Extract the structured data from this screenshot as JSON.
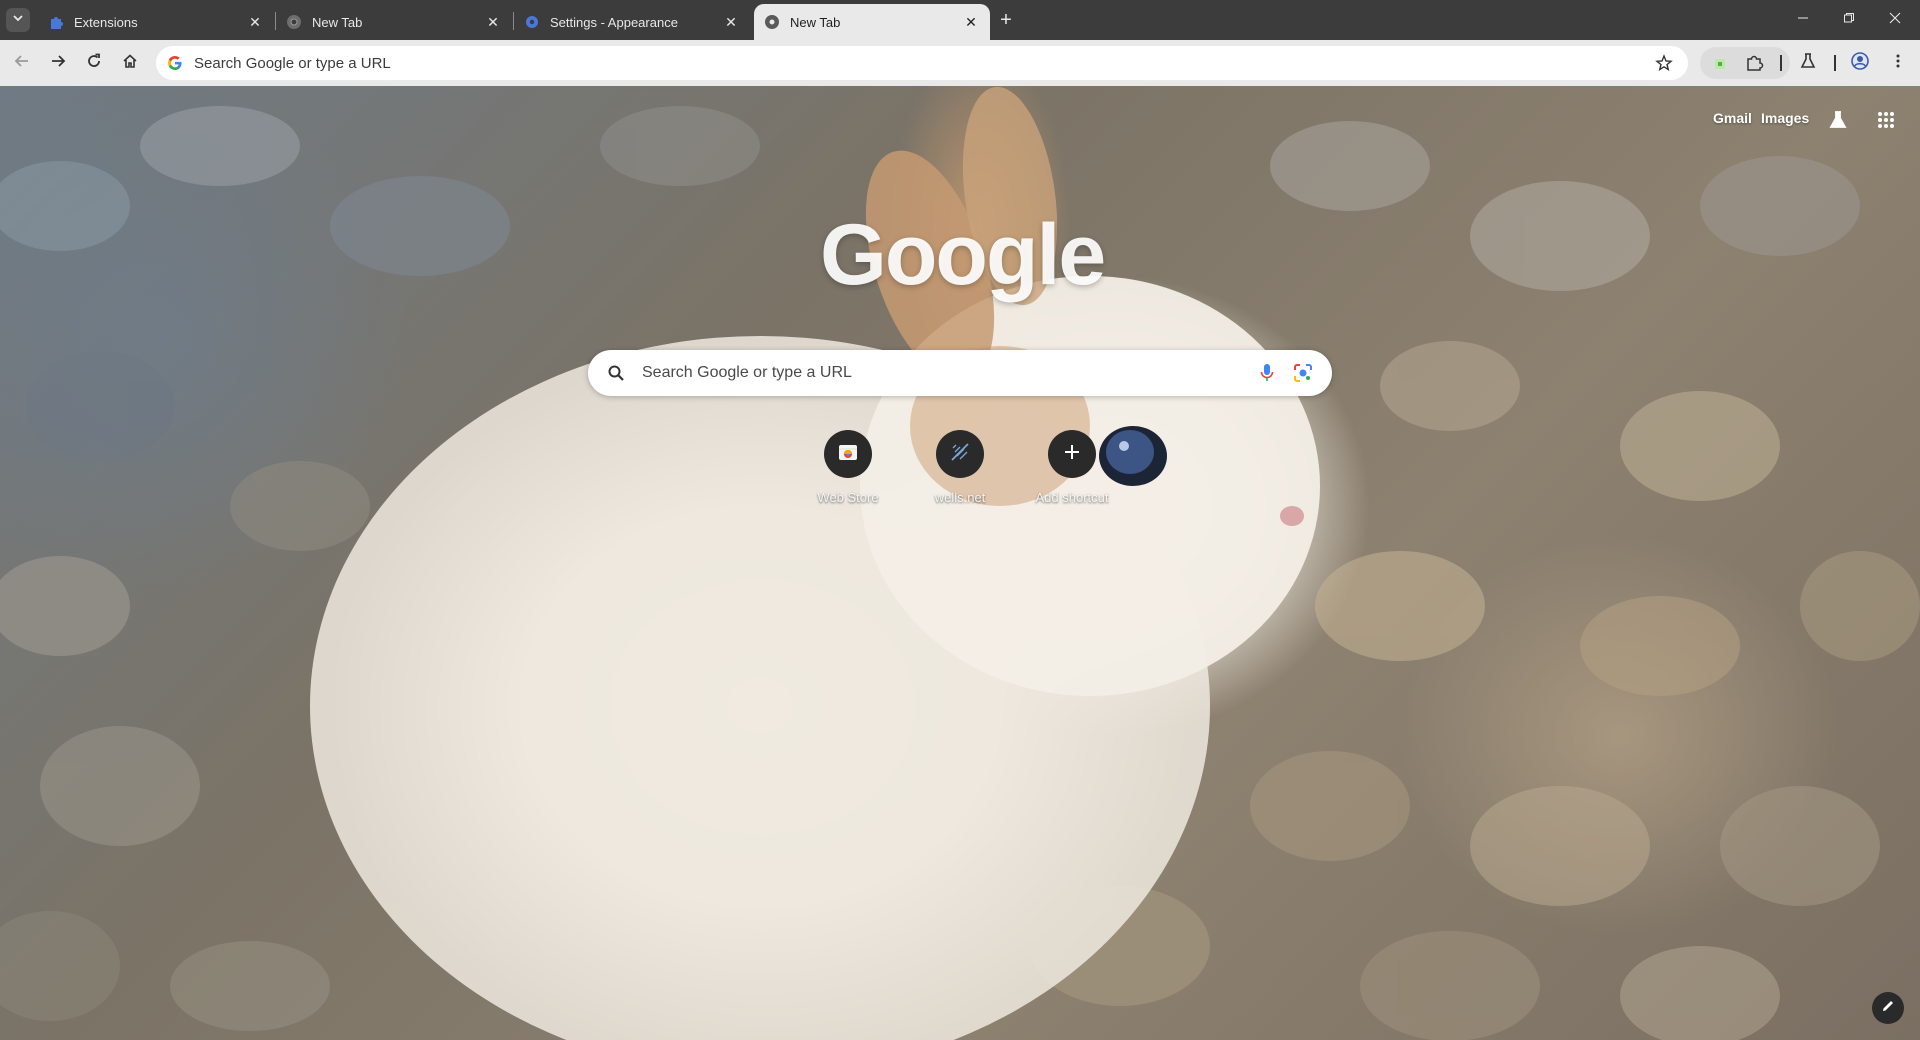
{
  "tabs": [
    {
      "title": "Extensions",
      "icon": "puzzle-icon",
      "active": false
    },
    {
      "title": "New Tab",
      "icon": "chrome-icon",
      "active": false
    },
    {
      "title": "Settings - Appearance",
      "icon": "gear-icon",
      "active": false
    },
    {
      "title": "New Tab",
      "icon": "chrome-icon",
      "active": true
    }
  ],
  "toolbar": {
    "omnibox_text": "Search Google or type a URL"
  },
  "ntp": {
    "gmail_label": "Gmail",
    "images_label": "Images",
    "logo_text": "Google",
    "search_placeholder": "Search Google or type a URL",
    "shortcuts": [
      {
        "label": "Web Store",
        "icon": "web-store-icon"
      },
      {
        "label": "wells.net",
        "icon": "wells-icon"
      },
      {
        "label": "Add shortcut",
        "icon": "plus-icon"
      }
    ]
  },
  "colors": {
    "tabstrip": "#3c3c3c",
    "toolbar": "#e9e9e9",
    "active_tab": "#e9e9e9",
    "shortcut_circle": "#2a2a2a",
    "accent_blue": "#4a78d8"
  }
}
